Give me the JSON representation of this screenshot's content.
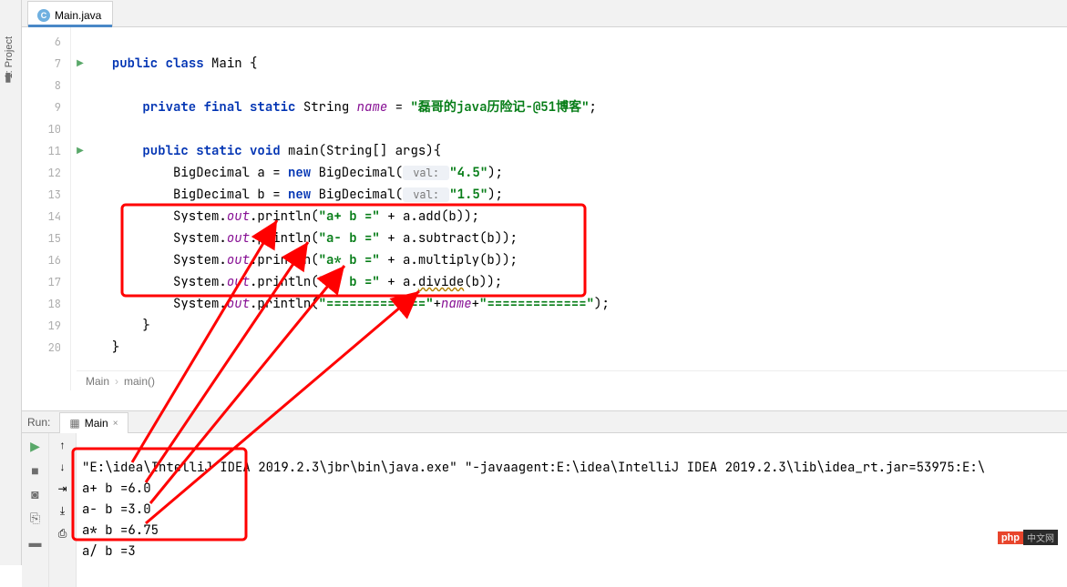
{
  "sidebar": {
    "project_label": "1: Project"
  },
  "tab": {
    "filename": "Main.java",
    "icon_letter": "C"
  },
  "gutter": {
    "lines": [
      "6",
      "7",
      "8",
      "9",
      "10",
      "11",
      "12",
      "13",
      "14",
      "15",
      "16",
      "17",
      "18",
      "19",
      "20"
    ]
  },
  "code": {
    "l7": {
      "kw_public": "public",
      "kw_class": "class",
      "cls": "Main",
      "brace": " {"
    },
    "l9": {
      "kw_private": "private",
      "kw_final": "final",
      "kw_static": "static",
      "type": "String",
      "field": "name",
      "eq": " = ",
      "str": "\"磊哥的java历险记-@51博客\"",
      "semi": ";"
    },
    "l11": {
      "kw_public": "public",
      "kw_static": "static",
      "kw_void": "void",
      "mth": "main",
      "args": "(String[] args){"
    },
    "l12": {
      "type": "BigDecimal",
      "var": " a = ",
      "kw_new": "new",
      "ctor": " BigDecimal(",
      "hint": " val: ",
      "str": "\"4.5\"",
      "close": ");"
    },
    "l13": {
      "type": "BigDecimal",
      "var": " b = ",
      "kw_new": "new",
      "ctor": " BigDecimal(",
      "hint": " val: ",
      "str": "\"1.5\"",
      "close": ");"
    },
    "l14": {
      "sys": "System.",
      "out": "out",
      "pr": ".println(",
      "str": "\"a+ b =\"",
      "plus": " + a.add(b));"
    },
    "l15": {
      "sys": "System.",
      "out": "out",
      "pr": ".println(",
      "str": "\"a- b =\"",
      "plus": " + a.subtract(b));"
    },
    "l16": {
      "sys": "System.",
      "out": "out",
      "pr": ".println(",
      "str": "\"a* b =\"",
      "plus": " + a.multiply(b));"
    },
    "l17": {
      "sys": "System.",
      "out": "out",
      "pr": ".println(",
      "str": "\"a/ b =\"",
      "plus_pre": " + a.",
      "warn": "divide",
      "plus_post": "(b));"
    },
    "l18": {
      "sys": "System.",
      "out": "out",
      "pr": ".println(",
      "str1": "\"=============\"",
      "plus1": "+",
      "field": "name",
      "plus2": "+",
      "str2": "\"=============\"",
      "close": ");"
    },
    "l19": {
      "brace": "}"
    },
    "l20": {
      "brace": "}"
    }
  },
  "breadcrumb": {
    "a": "Main",
    "b": "main()"
  },
  "run": {
    "label": "Run:",
    "tab": "Main",
    "cmd": "\"E:\\idea\\IntelliJ IDEA 2019.2.3\\jbr\\bin\\java.exe\" \"-javaagent:E:\\idea\\IntelliJ IDEA 2019.2.3\\lib\\idea_rt.jar=53975:E:\\",
    "o1": "a+ b =6.0",
    "o2": "a- b =3.0",
    "o3": "a* b =6.75",
    "o4": "a/ b =3"
  },
  "badge": {
    "php": "php",
    "cn": "中文网"
  }
}
